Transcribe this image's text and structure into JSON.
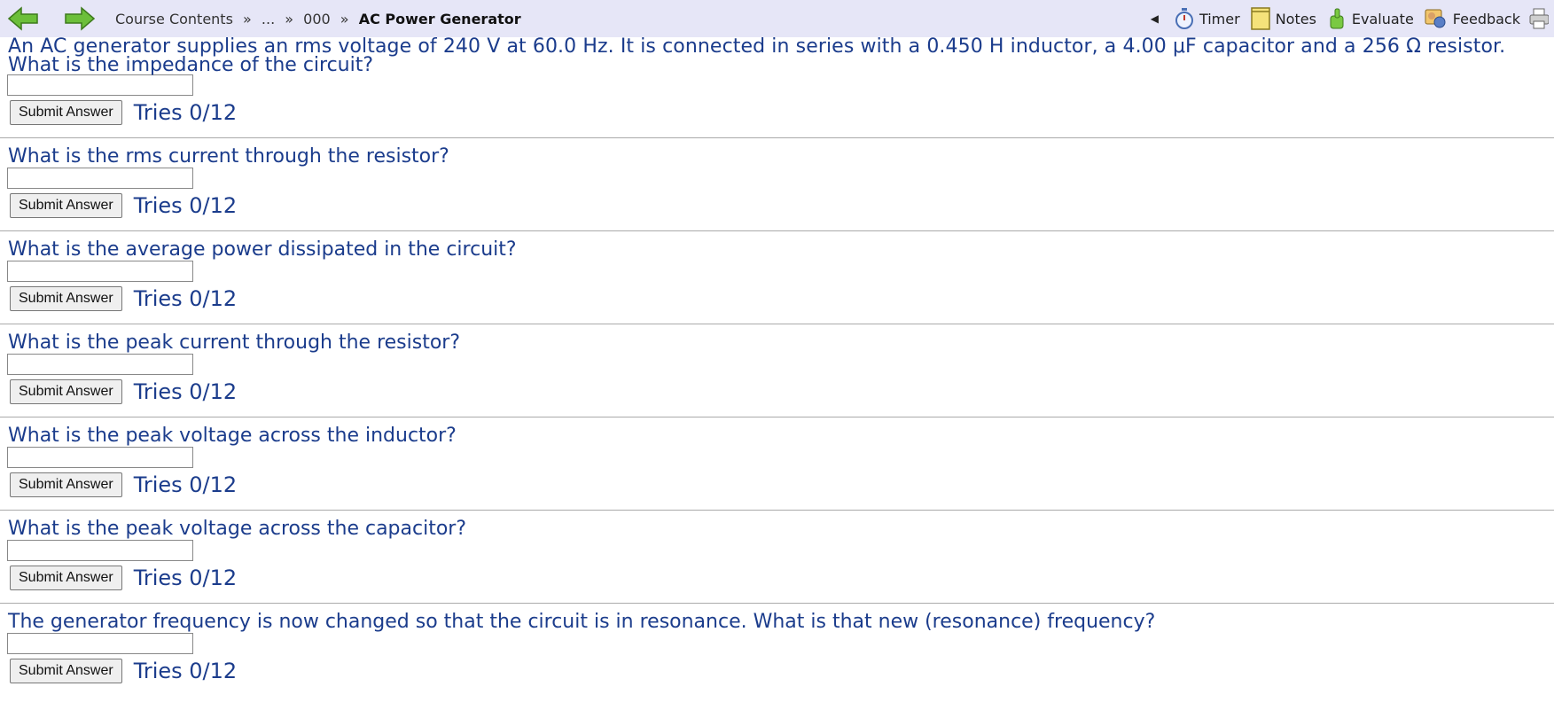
{
  "header": {
    "breadcrumb": {
      "course": "Course Contents",
      "sep1": "»",
      "ellipsis": "...",
      "sep2": "»",
      "folder": "000",
      "sep3": "»",
      "current": "AC Power Generator"
    },
    "tools": {
      "collapse": "◀",
      "timer": "Timer",
      "notes": "Notes",
      "evaluate": "Evaluate",
      "feedback": "Feedback"
    }
  },
  "problem": {
    "intro": "An AC generator supplies an rms voltage of 240 V at 60.0 Hz. It is connected in series with a 0.450 H inductor, a 4.00 μF capacitor and a 256 Ω resistor.",
    "submit_label": "Submit Answer",
    "parts": [
      {
        "question": "What is the impedance of the circuit?",
        "tries": "Tries 0/12",
        "value": ""
      },
      {
        "question": "What is the rms current through the resistor?",
        "tries": "Tries 0/12",
        "value": ""
      },
      {
        "question": "What is the average power dissipated in the circuit?",
        "tries": "Tries 0/12",
        "value": ""
      },
      {
        "question": "What is the peak current through the resistor?",
        "tries": "Tries 0/12",
        "value": ""
      },
      {
        "question": "What is the peak voltage across the inductor?",
        "tries": "Tries 0/12",
        "value": ""
      },
      {
        "question": "What is the peak voltage across the capacitor?",
        "tries": "Tries 0/12",
        "value": ""
      },
      {
        "question": "The generator frequency is now changed so that the circuit is in resonance. What is that new (resonance) frequency?",
        "tries": "Tries 0/12",
        "value": ""
      }
    ]
  },
  "icons": {
    "back": "back-arrow-icon",
    "forward": "forward-arrow-icon",
    "timer": "stopwatch-icon",
    "notes": "notepad-icon",
    "evaluate": "thumbs-up-icon",
    "feedback": "feedback-icon",
    "print": "printer-icon"
  },
  "colors": {
    "question_text": "#1b3c8c",
    "topbar_bg": "#e6e6f7",
    "nav_arrow": "#6cbf3a"
  }
}
